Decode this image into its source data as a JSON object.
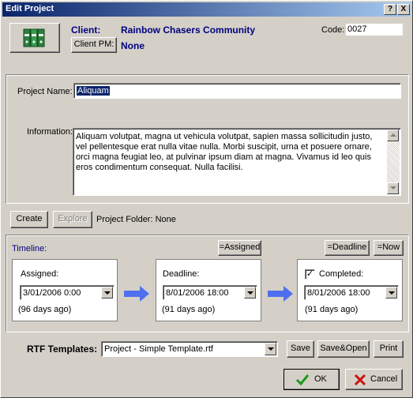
{
  "window": {
    "title": "Edit Project",
    "help_glyph": "?",
    "close_glyph": "X"
  },
  "header": {
    "client_label": "Client:",
    "client_value": "Rainbow Chasers Community",
    "client_pm_button": "Client PM:",
    "client_pm_value": "None",
    "code_label": "Code:",
    "code_value": "0027",
    "icon": "binders-icon"
  },
  "project": {
    "name_label": "Project Name:",
    "name_value": "Aliquam",
    "information_label": "Information:",
    "information_value": "Aliquam volutpat, magna ut vehicula volutpat, sapien massa sollicitudin justo, vel pellentesque erat nulla vitae nulla. Morbi suscipit, urna et posuere ornare, orci magna feugiat leo, at pulvinar ipsum diam at magna. Vivamus id leo quis eros condimentum consequat. Nulla facilisi."
  },
  "folder": {
    "create_button": "Create",
    "explore_button": "Explore",
    "folder_text": "Project Folder: None"
  },
  "timeline": {
    "label": "Timeline:",
    "assigned_button": "=Assigned",
    "deadline_button": "=Deadline",
    "now_button": "=Now",
    "assigned": {
      "label": "Assigned:",
      "value": "3/01/2006 0:00",
      "ago": "(96 days ago)"
    },
    "deadline": {
      "label": "Deadline:",
      "value": "8/01/2006 18:00",
      "ago": "(91 days ago)"
    },
    "completed": {
      "label": "Completed:",
      "checked": true,
      "check_glyph": "✓",
      "value": "8/01/2006 18:00",
      "ago": "(91 days ago)"
    },
    "arrow_color": "#4f6ff0"
  },
  "rtf": {
    "label": "RTF Templates:",
    "selected": "Project - Simple Template.rtf",
    "save_button": "Save",
    "save_open_button": "Save&Open",
    "print_button": "Print"
  },
  "footer": {
    "ok_button": "OK",
    "cancel_button": "Cancel"
  }
}
